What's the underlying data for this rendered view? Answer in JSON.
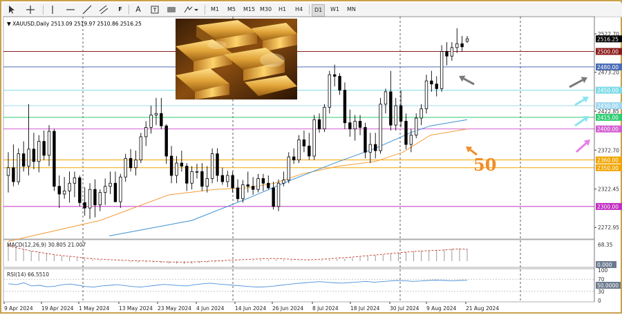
{
  "toolbar": {
    "icons": [
      "cursor-icon",
      "crosshair-icon",
      "vertical-line-icon",
      "horizontal-line-icon",
      "trendline-icon",
      "channel-icon",
      "fibonacci-icon",
      "text-icon",
      "label-icon",
      "rectangle-icon",
      "shapes-dropdown-icon"
    ],
    "text_tool": "A",
    "fib_tool": "F",
    "timeframes": [
      "M1",
      "M5",
      "M15",
      "M30",
      "H1",
      "H4",
      "D1",
      "W1",
      "MN"
    ]
  },
  "header": {
    "symbol": "XAUUSD,Daily",
    "ohlc": "2513.09 2519.97 2510.86 2516.25"
  },
  "colors": {
    "bull": "#000000",
    "bear": "#000000",
    "ma50": "#f29d38",
    "ma100": "#3a8fd1",
    "macd_signal": "#c0392b",
    "rsi": "#4a90d9",
    "arrow_gray": "#7a7a7a",
    "arrow_cyan": "#87e4f0",
    "arrow_pink": "#e87ee6",
    "annotation_orange": "#f28c28"
  },
  "chart_data": [
    {
      "type": "candlestick",
      "title": "XAUUSD,Daily",
      "ylim": [
        2258,
        2545
      ],
      "y_ticks": [
        2522.7,
        2473.2,
        2422.85,
        2372.7,
        2322.45,
        2272.95
      ],
      "x_labels": [
        "9 Apr 2024",
        "19 Apr 2024",
        "1 May 2024",
        "13 May 2024",
        "23 May 2024",
        "4 Jun 2024",
        "14 Jun 2024",
        "26 Jun 2024",
        "8 Jul 2024",
        "18 Jul 2024",
        "30 Jul 2024",
        "9 Aug 2024",
        "21 Aug 2024"
      ],
      "last_price": "2516.25",
      "candles": [
        {
          "o": 2340,
          "h": 2370,
          "l": 2318,
          "c": 2350
        },
        {
          "o": 2350,
          "h": 2380,
          "l": 2326,
          "c": 2332
        },
        {
          "o": 2332,
          "h": 2375,
          "l": 2328,
          "c": 2368
        },
        {
          "o": 2368,
          "h": 2384,
          "l": 2345,
          "c": 2352
        },
        {
          "o": 2352,
          "h": 2432,
          "l": 2340,
          "c": 2374
        },
        {
          "o": 2374,
          "h": 2395,
          "l": 2348,
          "c": 2358
        },
        {
          "o": 2358,
          "h": 2392,
          "l": 2344,
          "c": 2384
        },
        {
          "o": 2384,
          "h": 2398,
          "l": 2360,
          "c": 2366
        },
        {
          "o": 2366,
          "h": 2405,
          "l": 2352,
          "c": 2397
        },
        {
          "o": 2397,
          "h": 2400,
          "l": 2320,
          "c": 2326
        },
        {
          "o": 2326,
          "h": 2340,
          "l": 2298,
          "c": 2316
        },
        {
          "o": 2316,
          "h": 2338,
          "l": 2310,
          "c": 2320
        },
        {
          "o": 2320,
          "h": 2345,
          "l": 2305,
          "c": 2330
        },
        {
          "o": 2330,
          "h": 2345,
          "l": 2312,
          "c": 2337
        },
        {
          "o": 2337,
          "h": 2340,
          "l": 2300,
          "c": 2305
        },
        {
          "o": 2305,
          "h": 2325,
          "l": 2288,
          "c": 2298
        },
        {
          "o": 2298,
          "h": 2330,
          "l": 2284,
          "c": 2322
        },
        {
          "o": 2322,
          "h": 2335,
          "l": 2286,
          "c": 2302
        },
        {
          "o": 2302,
          "h": 2322,
          "l": 2294,
          "c": 2318
        },
        {
          "o": 2318,
          "h": 2336,
          "l": 2302,
          "c": 2326
        },
        {
          "o": 2326,
          "h": 2345,
          "l": 2316,
          "c": 2330
        },
        {
          "o": 2330,
          "h": 2345,
          "l": 2318,
          "c": 2306
        },
        {
          "o": 2306,
          "h": 2342,
          "l": 2298,
          "c": 2338
        },
        {
          "o": 2338,
          "h": 2368,
          "l": 2332,
          "c": 2362
        },
        {
          "o": 2362,
          "h": 2374,
          "l": 2345,
          "c": 2350
        },
        {
          "o": 2350,
          "h": 2372,
          "l": 2340,
          "c": 2360
        },
        {
          "o": 2360,
          "h": 2395,
          "l": 2356,
          "c": 2390
        },
        {
          "o": 2390,
          "h": 2410,
          "l": 2378,
          "c": 2402
        },
        {
          "o": 2402,
          "h": 2430,
          "l": 2394,
          "c": 2418
        },
        {
          "o": 2418,
          "h": 2440,
          "l": 2405,
          "c": 2420
        },
        {
          "o": 2420,
          "h": 2440,
          "l": 2400,
          "c": 2404
        },
        {
          "o": 2404,
          "h": 2406,
          "l": 2355,
          "c": 2365
        },
        {
          "o": 2365,
          "h": 2378,
          "l": 2330,
          "c": 2340
        },
        {
          "o": 2340,
          "h": 2365,
          "l": 2330,
          "c": 2356
        },
        {
          "o": 2356,
          "h": 2372,
          "l": 2345,
          "c": 2352
        },
        {
          "o": 2352,
          "h": 2356,
          "l": 2320,
          "c": 2330
        },
        {
          "o": 2330,
          "h": 2352,
          "l": 2322,
          "c": 2345
        },
        {
          "o": 2345,
          "h": 2355,
          "l": 2336,
          "c": 2345
        },
        {
          "o": 2345,
          "h": 2356,
          "l": 2320,
          "c": 2326
        },
        {
          "o": 2326,
          "h": 2352,
          "l": 2318,
          "c": 2336
        },
        {
          "o": 2336,
          "h": 2375,
          "l": 2330,
          "c": 2368
        },
        {
          "o": 2368,
          "h": 2375,
          "l": 2332,
          "c": 2340
        },
        {
          "o": 2340,
          "h": 2350,
          "l": 2328,
          "c": 2332
        },
        {
          "o": 2332,
          "h": 2346,
          "l": 2325,
          "c": 2340
        },
        {
          "o": 2340,
          "h": 2345,
          "l": 2318,
          "c": 2324
        },
        {
          "o": 2324,
          "h": 2335,
          "l": 2306,
          "c": 2310
        },
        {
          "o": 2310,
          "h": 2334,
          "l": 2305,
          "c": 2328
        },
        {
          "o": 2328,
          "h": 2345,
          "l": 2318,
          "c": 2326
        },
        {
          "o": 2326,
          "h": 2338,
          "l": 2315,
          "c": 2322
        },
        {
          "o": 2322,
          "h": 2342,
          "l": 2318,
          "c": 2336
        },
        {
          "o": 2336,
          "h": 2342,
          "l": 2320,
          "c": 2330
        },
        {
          "o": 2330,
          "h": 2340,
          "l": 2322,
          "c": 2324
        },
        {
          "o": 2324,
          "h": 2332,
          "l": 2296,
          "c": 2300
        },
        {
          "o": 2300,
          "h": 2335,
          "l": 2294,
          "c": 2330
        },
        {
          "o": 2330,
          "h": 2345,
          "l": 2326,
          "c": 2334
        },
        {
          "o": 2334,
          "h": 2370,
          "l": 2330,
          "c": 2364
        },
        {
          "o": 2364,
          "h": 2375,
          "l": 2355,
          "c": 2360
        },
        {
          "o": 2360,
          "h": 2392,
          "l": 2356,
          "c": 2386
        },
        {
          "o": 2386,
          "h": 2398,
          "l": 2370,
          "c": 2378
        },
        {
          "o": 2378,
          "h": 2395,
          "l": 2360,
          "c": 2365
        },
        {
          "o": 2365,
          "h": 2418,
          "l": 2360,
          "c": 2412
        },
        {
          "o": 2412,
          "h": 2420,
          "l": 2395,
          "c": 2400
        },
        {
          "o": 2400,
          "h": 2432,
          "l": 2396,
          "c": 2428
        },
        {
          "o": 2428,
          "h": 2475,
          "l": 2420,
          "c": 2470
        },
        {
          "o": 2470,
          "h": 2483,
          "l": 2455,
          "c": 2468
        },
        {
          "o": 2468,
          "h": 2472,
          "l": 2444,
          "c": 2450
        },
        {
          "o": 2450,
          "h": 2460,
          "l": 2400,
          "c": 2408
        },
        {
          "o": 2408,
          "h": 2425,
          "l": 2390,
          "c": 2400
        },
        {
          "o": 2400,
          "h": 2418,
          "l": 2385,
          "c": 2410
        },
        {
          "o": 2410,
          "h": 2418,
          "l": 2392,
          "c": 2402
        },
        {
          "o": 2402,
          "h": 2408,
          "l": 2362,
          "c": 2370
        },
        {
          "o": 2370,
          "h": 2395,
          "l": 2356,
          "c": 2380
        },
        {
          "o": 2380,
          "h": 2395,
          "l": 2362,
          "c": 2372
        },
        {
          "o": 2372,
          "h": 2440,
          "l": 2368,
          "c": 2432
        },
        {
          "o": 2432,
          "h": 2452,
          "l": 2420,
          "c": 2448
        },
        {
          "o": 2448,
          "h": 2475,
          "l": 2398,
          "c": 2405
        },
        {
          "o": 2405,
          "h": 2440,
          "l": 2398,
          "c": 2430
        },
        {
          "o": 2430,
          "h": 2450,
          "l": 2402,
          "c": 2410
        },
        {
          "o": 2410,
          "h": 2420,
          "l": 2374,
          "c": 2380
        },
        {
          "o": 2380,
          "h": 2400,
          "l": 2370,
          "c": 2392
        },
        {
          "o": 2392,
          "h": 2420,
          "l": 2388,
          "c": 2414
        },
        {
          "o": 2414,
          "h": 2432,
          "l": 2405,
          "c": 2426
        },
        {
          "o": 2426,
          "h": 2470,
          "l": 2420,
          "c": 2462
        },
        {
          "o": 2462,
          "h": 2475,
          "l": 2448,
          "c": 2458
        },
        {
          "o": 2458,
          "h": 2468,
          "l": 2442,
          "c": 2452
        },
        {
          "o": 2452,
          "h": 2508,
          "l": 2448,
          "c": 2500
        },
        {
          "o": 2500,
          "h": 2512,
          "l": 2482,
          "c": 2494
        },
        {
          "o": 2494,
          "h": 2512,
          "l": 2488,
          "c": 2505
        },
        {
          "o": 2505,
          "h": 2530,
          "l": 2498,
          "c": 2510
        },
        {
          "o": 2510,
          "h": 2520,
          "l": 2500,
          "c": 2506
        },
        {
          "o": 2513.09,
          "h": 2519.97,
          "l": 2510.86,
          "c": 2516.25
        }
      ],
      "ma50": [
        [
          0,
          2255
        ],
        [
          20,
          2282
        ],
        [
          35,
          2315
        ],
        [
          45,
          2322
        ],
        [
          52,
          2324
        ],
        [
          58,
          2330
        ],
        [
          64,
          2342
        ],
        [
          72,
          2352
        ],
        [
          80,
          2358
        ],
        [
          86,
          2370
        ],
        [
          92,
          2392
        ],
        [
          100,
          2400
        ]
      ],
      "ma100": [
        [
          22,
          2262
        ],
        [
          40,
          2282
        ],
        [
          52,
          2310
        ],
        [
          62,
          2335
        ],
        [
          72,
          2358
        ],
        [
          80,
          2375
        ],
        [
          88,
          2396
        ],
        [
          92,
          2404
        ],
        [
          100,
          2412
        ]
      ],
      "levels": [
        {
          "value": 2500.0,
          "label": "2500.00",
          "color": "#8b1a1a"
        },
        {
          "value": 2480.0,
          "label": "2480.00",
          "color": "#4b6cb7"
        },
        {
          "value": 2450.0,
          "label": "2450.00",
          "color": "#7fdbe7"
        },
        {
          "value": 2430.0,
          "label": "2430.00",
          "color": "#9fd8ef"
        },
        {
          "value": 2415.0,
          "label": "2415.00",
          "color": "#2ecc71"
        },
        {
          "value": 2400.0,
          "label": "2400.00",
          "color": "#d35fd1"
        },
        {
          "value": 2360.0,
          "label": "2360.00",
          "color": "#f0a500"
        },
        {
          "value": 2350.0,
          "label": "2350.00",
          "color": "#f0a500"
        },
        {
          "value": 2300.0,
          "label": "2300.00",
          "color": "#c22fc2"
        }
      ],
      "annotation": "50"
    },
    {
      "type": "bar",
      "title": "MACD(12,26,9) 30.805 21.007",
      "y_ticks": [
        "68.35",
        "0.000"
      ],
      "description_values": [
        40,
        35,
        30,
        25,
        22,
        18,
        15,
        12,
        10,
        8,
        5,
        3,
        2,
        1,
        0,
        -1,
        -2,
        -3,
        -3,
        -4,
        -5,
        -6,
        -6,
        -7,
        -6,
        -5,
        -4,
        -3,
        -2,
        -1,
        0,
        1,
        2,
        3,
        4,
        4,
        3,
        2,
        1,
        0,
        1,
        2,
        3,
        5,
        6,
        8,
        10,
        12,
        14,
        16,
        18,
        20,
        22,
        24,
        25,
        26,
        27,
        28,
        30,
        31,
        30
      ]
    },
    {
      "type": "line",
      "title": "RSI(14) 66.5510",
      "ylim": [
        0,
        100
      ],
      "y_ticks": [
        "100",
        "70",
        "50.0000",
        "30",
        "0"
      ],
      "values": [
        55,
        52,
        58,
        48,
        50,
        45,
        47,
        52,
        54,
        50,
        46,
        44,
        48,
        50,
        52,
        49,
        46,
        44,
        47,
        50,
        53,
        51,
        49,
        48,
        52,
        55,
        57,
        54,
        52,
        50,
        48,
        46,
        44,
        45,
        47,
        50,
        53,
        56,
        58,
        60,
        62,
        60,
        58,
        57,
        59,
        61,
        63,
        60,
        62,
        64,
        66,
        65,
        63,
        64,
        66,
        67,
        66,
        65,
        66,
        66.5
      ]
    }
  ]
}
